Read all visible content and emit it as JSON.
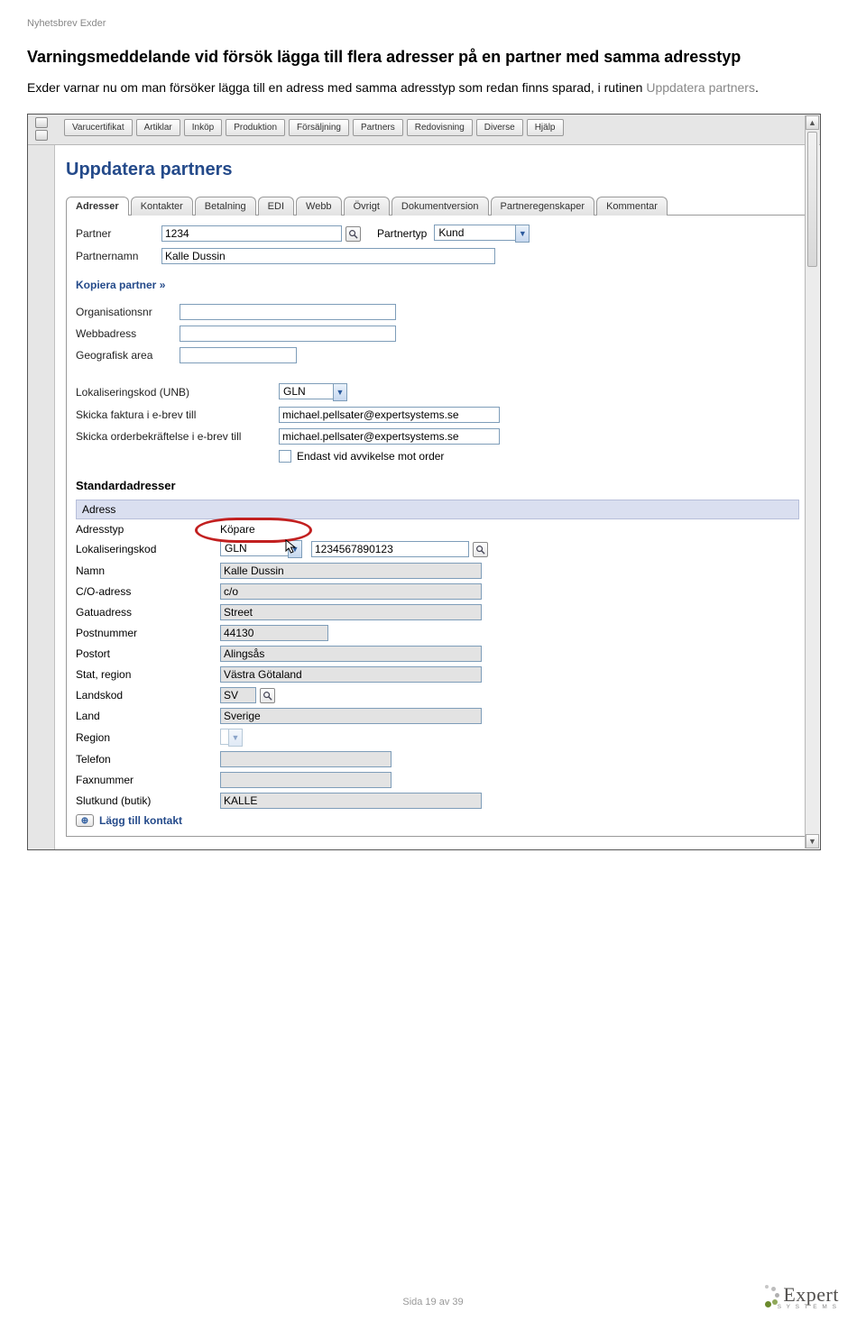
{
  "header_small": "Nyhetsbrev Exder",
  "section_title": "Varningsmeddelande vid försök lägga till flera adresser på en partner med samma adresstyp",
  "body_text_dark": "Exder varnar nu om man försöker lägga till en adress med samma adresstyp som redan finns sparad, i rutinen ",
  "body_text_light": "Uppdatera partners",
  "body_text_end": ".",
  "menu": [
    "Varucertifikat",
    "Artiklar",
    "Inköp",
    "Produktion",
    "Försäljning",
    "Partners",
    "Redovisning",
    "Diverse",
    "Hjälp"
  ],
  "page_title": "Uppdatera partners",
  "tabs": [
    "Adresser",
    "Kontakter",
    "Betalning",
    "EDI",
    "Webb",
    "Övrigt",
    "Dokumentversion",
    "Partneregenskaper",
    "Kommentar"
  ],
  "partner": {
    "partner_label": "Partner",
    "partner_value": "1234",
    "partnertyp_label": "Partnertyp",
    "partnertyp_value": "Kund",
    "partnernamn_label": "Partnernamn",
    "partnernamn_value": "Kalle Dussin"
  },
  "copy_link": "Kopiera partner »",
  "fields1": {
    "org_label": "Organisationsnr",
    "web_label": "Webbadress",
    "geo_label": "Geografisk area"
  },
  "fields2": {
    "lok_label": "Lokaliseringskod (UNB)",
    "lok_value": "GLN",
    "faktura_label": "Skicka faktura i e-brev till",
    "faktura_value": "michael.pellsater@expertsystems.se",
    "orderbek_label": "Skicka orderbekräftelse i e-brev till",
    "orderbek_value": "michael.pellsater@expertsystems.se",
    "avvik_label": "Endast vid avvikelse mot order"
  },
  "subheader": "Standardadresser",
  "adr_band": "Adress",
  "adr": {
    "adresstyp_label": "Adresstyp",
    "adresstyp_value": "Köpare",
    "lok_label": "Lokaliseringskod",
    "lok_sel": "GLN",
    "lok_val": "1234567890123",
    "namn_label": "Namn",
    "namn_value": "Kalle Dussin",
    "co_label": "C/O-adress",
    "co_value": "c/o",
    "gatu_label": "Gatuadress",
    "gatu_value": "Street",
    "postnr_label": "Postnummer",
    "postnr_value": "44130",
    "postort_label": "Postort",
    "postort_value": "Alingsås",
    "stat_label": "Stat, region",
    "stat_value": "Västra Götaland",
    "landskod_label": "Landskod",
    "landskod_value": "SV",
    "land_label": "Land",
    "land_value": "Sverige",
    "region_label": "Region",
    "tel_label": "Telefon",
    "fax_label": "Faxnummer",
    "slutkund_label": "Slutkund (butik)",
    "slutkund_value": "KALLE"
  },
  "add_contact": "Lägg till kontakt",
  "footer": "Sida 19 av 39",
  "logo_brand": "Expert",
  "logo_sys": "S Y S T E M S"
}
